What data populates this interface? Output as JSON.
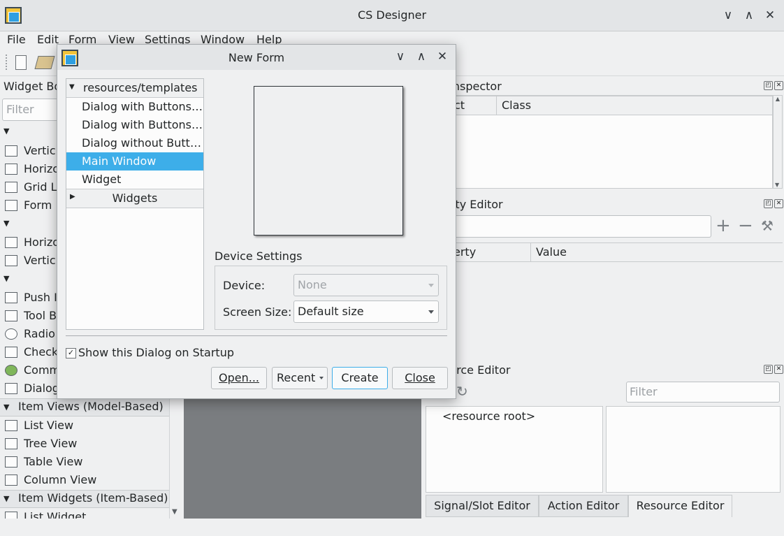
{
  "app": {
    "title": "CS Designer",
    "window_buttons": [
      "chevron-down-icon",
      "chevron-up-icon",
      "close-icon"
    ],
    "window_glyphs": [
      "∨",
      "∧",
      "✕"
    ]
  },
  "menu": {
    "items": [
      {
        "label": "File"
      },
      {
        "label": "Edit"
      },
      {
        "label": "Form"
      },
      {
        "label": "View"
      },
      {
        "label": "Settings"
      },
      {
        "label": "Window"
      },
      {
        "label": "Help"
      }
    ]
  },
  "widget_box": {
    "title": "Widget Bo",
    "filter_placeholder": "Filter",
    "rows": [
      {
        "label": "Vertic"
      },
      {
        "label": "Horizo"
      },
      {
        "label": "Grid L"
      },
      {
        "label": "Form"
      },
      {
        "label": "Horizo"
      },
      {
        "label": "Vertic"
      },
      {
        "label": "Push I"
      },
      {
        "label": "Tool B"
      },
      {
        "label": "Radio"
      },
      {
        "label": "Check"
      },
      {
        "label": "Comm"
      },
      {
        "label": "Dialog"
      },
      {
        "label": "List View"
      },
      {
        "label": "Tree View"
      },
      {
        "label": "Table View"
      },
      {
        "label": "Column View"
      },
      {
        "label": "List Widget"
      }
    ],
    "categories": [
      {
        "label": "Item Views (Model-Based)"
      },
      {
        "label": "Item Widgets (Item-Based)"
      }
    ]
  },
  "object_inspector": {
    "title": "ct Inspector",
    "col_object": "ct",
    "col_class": "Class"
  },
  "property_editor": {
    "title": "erty Editor",
    "col_property": "erty",
    "col_value": "Value"
  },
  "resource_editor": {
    "title": "urce Editor",
    "filter_placeholder": "Filter",
    "root_label": "<resource root>"
  },
  "bottom_tabs": [
    {
      "label": "Signal/Slot Editor"
    },
    {
      "label": "Action Editor"
    },
    {
      "label": "Resource Editor",
      "active": true
    }
  ],
  "dialog": {
    "title": "New Form",
    "tree": {
      "header": "resources/templates",
      "items": [
        {
          "label": "Dialog with Buttons…"
        },
        {
          "label": "Dialog with Buttons…"
        },
        {
          "label": "Dialog without Butt…"
        },
        {
          "label": "Main Window",
          "selected": true
        },
        {
          "label": "Widget"
        }
      ],
      "group": "Widgets"
    },
    "device_settings": {
      "title": "Device Settings",
      "device_label": "Device:",
      "device_value": "None",
      "screen_label": "Screen Size:",
      "screen_value": "Default size"
    },
    "startup_checkbox": {
      "label": "Show this Dialog on Startup",
      "checked": true,
      "mark": "✓"
    },
    "buttons": {
      "open": "Open...",
      "recent": "Recent",
      "create": "Create",
      "close": "Close"
    }
  }
}
